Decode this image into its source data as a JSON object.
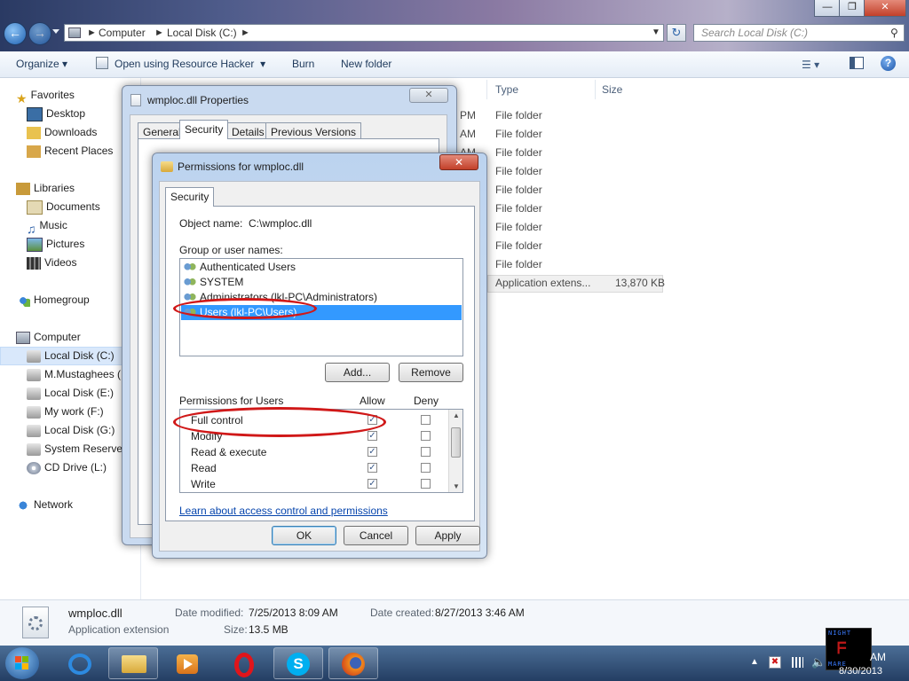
{
  "explorer": {
    "breadcrumb": [
      "Computer",
      "Local Disk (C:)"
    ],
    "search_placeholder": "Search Local Disk (C:)",
    "window_buttons": {
      "minimize": "—",
      "maximize": "❐",
      "close": "✕"
    },
    "toolbar": {
      "organize": "Organize",
      "open_with": "Open using Resource Hacker",
      "burn": "Burn",
      "new_folder": "New folder"
    },
    "columns": {
      "type": "Type",
      "size": "Size"
    },
    "nav": {
      "favorites": "Favorites",
      "desktop": "Desktop",
      "downloads": "Downloads",
      "recent": "Recent Places",
      "libraries": "Libraries",
      "documents": "Documents",
      "music": "Music",
      "pictures": "Pictures",
      "videos": "Videos",
      "homegroup": "Homegroup",
      "computer": "Computer",
      "local_c": "Local Disk (C:)",
      "mustaghees": "M.Mustaghees (",
      "local_e": "Local Disk (E:)",
      "mywork": "My work (F:)",
      "local_g": "Local Disk (G:)",
      "sysres": "System Reserved",
      "cddrive": "CD Drive (L:)",
      "network": "Network"
    },
    "rows": [
      {
        "time": "PM",
        "type": "File folder",
        "size": ""
      },
      {
        "time": "AM",
        "type": "File folder",
        "size": ""
      },
      {
        "time": "AM",
        "type": "File folder",
        "size": ""
      },
      {
        "time": "",
        "type": "File folder",
        "size": ""
      },
      {
        "time": "",
        "type": "File folder",
        "size": ""
      },
      {
        "time": "",
        "type": "File folder",
        "size": ""
      },
      {
        "time": "",
        "type": "File folder",
        "size": ""
      },
      {
        "time": "",
        "type": "File folder",
        "size": ""
      },
      {
        "time": "",
        "type": "File folder",
        "size": ""
      },
      {
        "time": "",
        "type": "Application extens...",
        "size": "13,870 KB"
      }
    ],
    "details": {
      "filename": "wmploc.dll",
      "filetype": "Application extension",
      "modified_label": "Date modified:",
      "modified_value": "7/25/2013 8:09 AM",
      "size_label": "Size:",
      "size_value": "13.5 MB",
      "created_label": "Date created:",
      "created_value": "8/27/2013 3:46 AM"
    }
  },
  "properties": {
    "title": "wmploc.dll Properties",
    "tabs": [
      "General",
      "Security",
      "Details",
      "Previous Versions"
    ]
  },
  "permissions": {
    "title": "Permissions for wmploc.dll",
    "tab": "Security",
    "object_label": "Object name:",
    "object_value": "C:\\wmploc.dll",
    "group_label": "Group or user names:",
    "users": [
      "Authenticated Users",
      "SYSTEM",
      "Administrators (lkl-PC\\Administrators)",
      "Users (lkl-PC\\Users)"
    ],
    "add": "Add...",
    "remove": "Remove",
    "perm_label": "Permissions for Users",
    "allow": "Allow",
    "deny": "Deny",
    "perms": [
      {
        "name": "Full control",
        "allow": true,
        "deny": false
      },
      {
        "name": "Modify",
        "allow": true,
        "deny": false
      },
      {
        "name": "Read & execute",
        "allow": true,
        "deny": false
      },
      {
        "name": "Read",
        "allow": true,
        "deny": false
      },
      {
        "name": "Write",
        "allow": true,
        "deny": false
      }
    ],
    "link": "Learn about access control and permissions",
    "ok": "OK",
    "cancel": "Cancel",
    "apply": "Apply"
  },
  "taskbar": {
    "clock_time": "AM",
    "clock_date": "8/30/2013",
    "logo_lines": [
      "NIGHT",
      "MARE"
    ]
  },
  "colors": {
    "selection": "#3399ff",
    "annotation": "#d01818",
    "link": "#0645ad"
  }
}
